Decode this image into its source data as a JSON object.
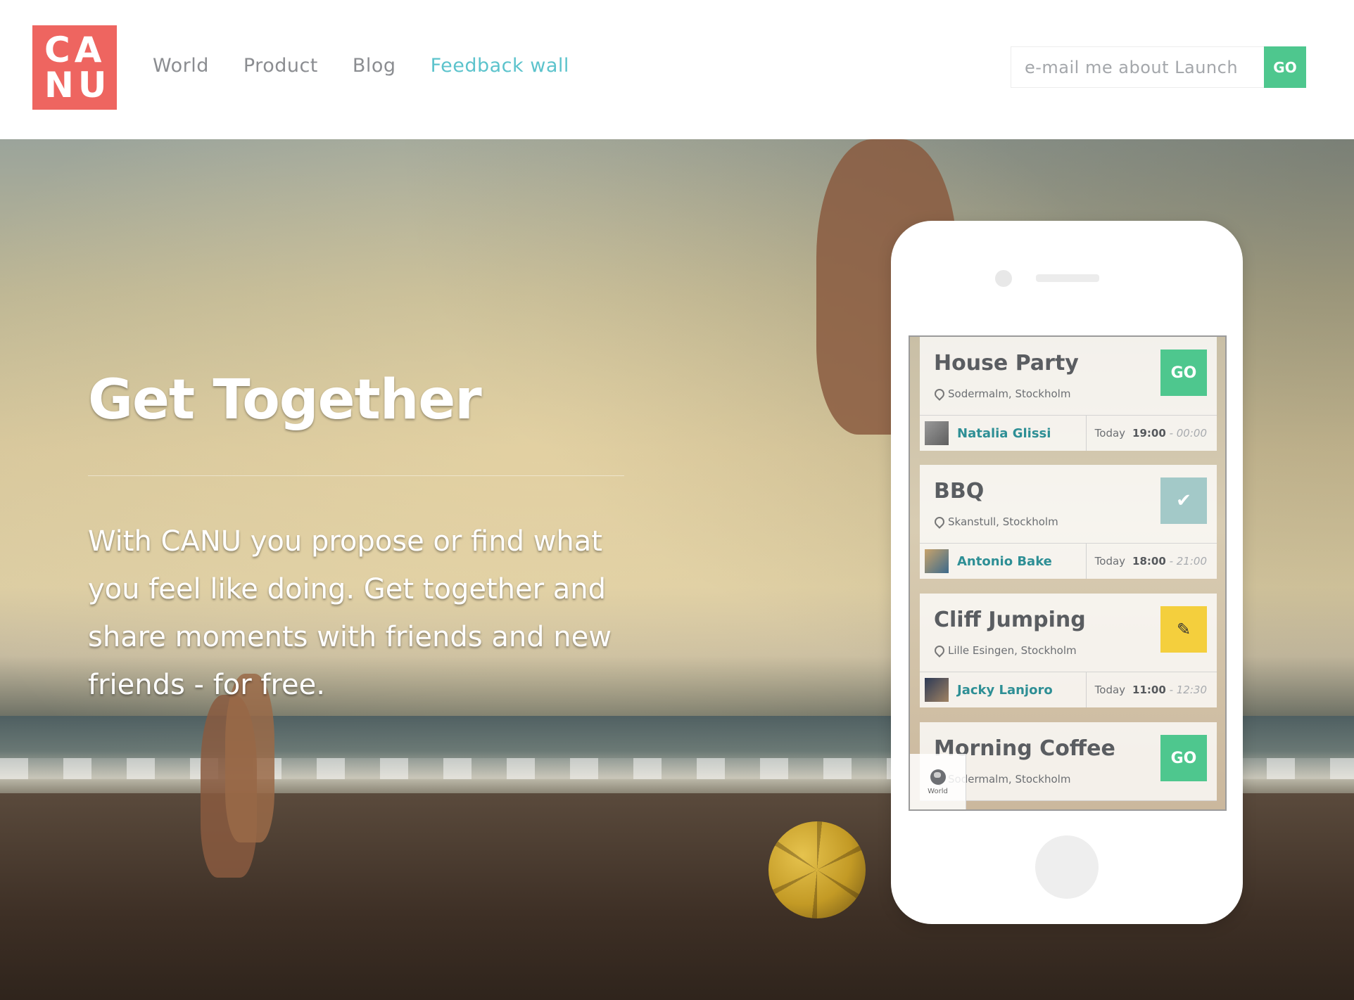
{
  "header": {
    "logo": {
      "line1": "CA",
      "line2": "NU"
    },
    "nav": [
      {
        "label": "World"
      },
      {
        "label": "Product"
      },
      {
        "label": "Blog"
      },
      {
        "label": "Feedback wall"
      }
    ],
    "email_placeholder": "e-mail me about Launch",
    "email_go_label": "GO"
  },
  "hero": {
    "title": "Get Together",
    "text": "With CANU you propose or find what you feel like doing. Get together and share moments with friends and new friends - for free."
  },
  "phone": {
    "events": [
      {
        "title": "House Party",
        "location": "Sodermalm, Stockholm",
        "host": "Natalia Glissi",
        "day": "Today",
        "start": "19:00",
        "end": "- 00:00",
        "action": "GO"
      },
      {
        "title": "BBQ",
        "location": "Skanstull, Stockholm",
        "host": "Antonio Bake",
        "day": "Today",
        "start": "18:00",
        "end": "- 21:00",
        "action": "✔"
      },
      {
        "title": "Cliff Jumping",
        "location": "Lille Esingen, Stockholm",
        "host": "Jacky Lanjoro",
        "day": "Today",
        "start": "11:00",
        "end": "- 12:30",
        "action": "✎"
      },
      {
        "title": "Morning Coffee",
        "location": "Sodermalm, Stockholm",
        "action": "GO"
      }
    ],
    "world_tab_label": "World"
  },
  "colors": {
    "logo": "#ee6560",
    "nav_active": "#5cc3cc",
    "go_green": "#4ec78e",
    "check_teal": "#a3c9c8",
    "edit_yellow": "#f4cf3d",
    "host_name": "#2e8f95"
  },
  "icons": [
    "location-pin-icon",
    "check-icon",
    "pencil-icon",
    "globe-icon"
  ]
}
